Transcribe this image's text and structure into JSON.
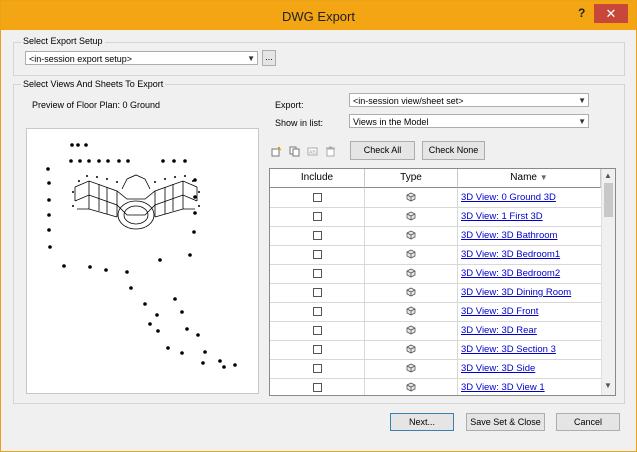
{
  "window": {
    "title": "DWG Export",
    "help": "?",
    "close": "✕"
  },
  "setup": {
    "group_label": "Select Export Setup",
    "value": "<in-session export setup>",
    "browse_label": "..."
  },
  "views": {
    "group_label": "Select Views And Sheets To Export",
    "preview_label": "Preview of Floor Plan: 0 Ground",
    "export_label": "Export:",
    "export_value": "<in-session view/sheet set>",
    "show_label": "Show in list:",
    "show_value": "Views in the Model",
    "check_all": "Check All",
    "check_none": "Check None",
    "toolbar_icons": [
      "new-set-icon",
      "duplicate-set-icon",
      "rename-set-icon",
      "delete-set-icon"
    ]
  },
  "table": {
    "columns": [
      "Include",
      "Type",
      "Name"
    ],
    "sort_indicator": "▼",
    "rows": [
      {
        "include": false,
        "type_icon": "3d-view-icon",
        "name": "3D View: 0 Ground 3D"
      },
      {
        "include": false,
        "type_icon": "3d-view-icon",
        "name": "3D View: 1 First 3D"
      },
      {
        "include": false,
        "type_icon": "3d-view-icon",
        "name": "3D View: 3D Bathroom"
      },
      {
        "include": false,
        "type_icon": "3d-view-icon",
        "name": "3D View: 3D Bedroom1"
      },
      {
        "include": false,
        "type_icon": "3d-view-icon",
        "name": "3D View: 3D Bedroom2"
      },
      {
        "include": false,
        "type_icon": "3d-view-icon",
        "name": "3D View: 3D Dining Room"
      },
      {
        "include": false,
        "type_icon": "3d-view-icon",
        "name": "3D View: 3D Front"
      },
      {
        "include": false,
        "type_icon": "3d-view-icon",
        "name": "3D View: 3D Rear"
      },
      {
        "include": false,
        "type_icon": "3d-view-icon",
        "name": "3D View: 3D Section 3"
      },
      {
        "include": false,
        "type_icon": "3d-view-icon",
        "name": "3D View: 3D Side"
      },
      {
        "include": false,
        "type_icon": "3d-view-icon",
        "name": "3D View: 3D View 1"
      }
    ]
  },
  "footer": {
    "next": "Next...",
    "save_close": "Save Set & Close",
    "cancel": "Cancel"
  }
}
